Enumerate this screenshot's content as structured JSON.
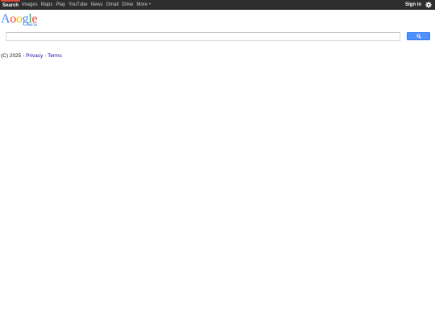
{
  "nav": {
    "items": [
      {
        "label": "Search",
        "active": true
      },
      {
        "label": "Images"
      },
      {
        "label": "Maps"
      },
      {
        "label": "Play"
      },
      {
        "label": "YouTube"
      },
      {
        "label": "News"
      },
      {
        "label": "Gmail"
      },
      {
        "label": "Drive"
      },
      {
        "label": "More"
      }
    ],
    "more_icon": "chevron-down-icon",
    "signin_label": "Sign in",
    "settings_icon": "gear-icon"
  },
  "logo": {
    "letters": [
      "A",
      "o",
      "o",
      "g",
      "l",
      "e"
    ],
    "letter_colors": [
      "#4285f4",
      "#ea4335",
      "#fbbc05",
      "#4285f4",
      "#34a853",
      "#ea4335"
    ],
    "badge": "BETA"
  },
  "search": {
    "value": "",
    "placeholder": "",
    "button_icon": "search-icon"
  },
  "footer": {
    "copyright": "(C) 2025 - ",
    "privacy_label": "Privacy",
    "separator": " - ",
    "terms_label": "Terms"
  },
  "colors": {
    "topbar_bg": "#2d2d2d",
    "active_accent": "#dd4b39",
    "search_button": "#4d90fe",
    "link": "#1a0dab"
  }
}
